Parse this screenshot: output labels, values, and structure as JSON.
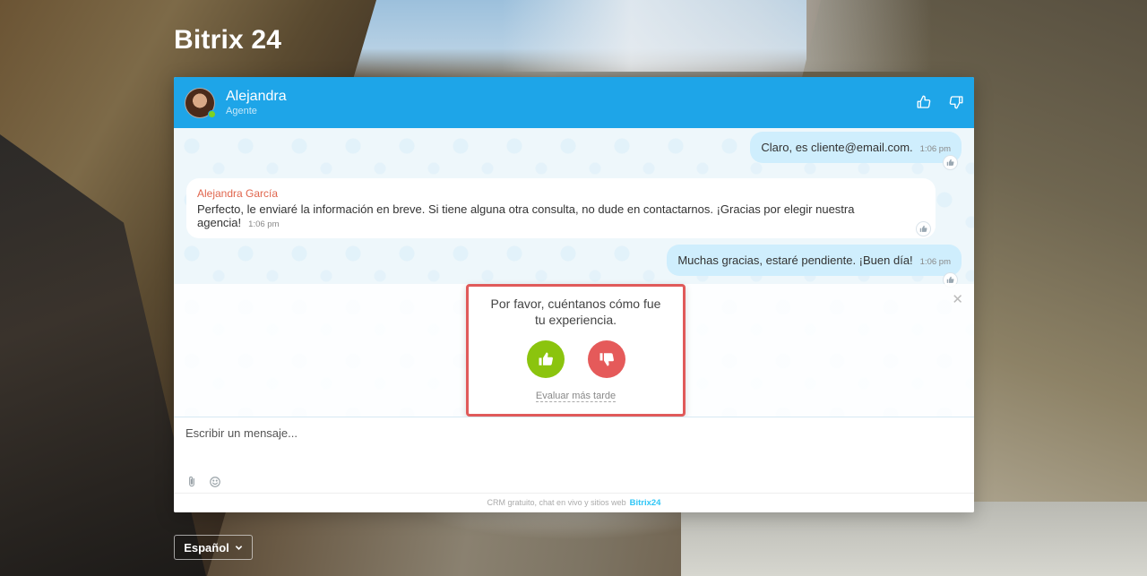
{
  "brand": {
    "title": "Bitrix 24"
  },
  "header": {
    "agent_name": "Alejandra",
    "agent_role": "Agente",
    "like_icon": "thumbs-up-icon",
    "dislike_icon": "thumbs-down-icon"
  },
  "messages": [
    {
      "direction": "out",
      "text": "Claro, es cliente@email.com.",
      "time": "1:06 pm"
    },
    {
      "direction": "in",
      "author": "Alejandra García",
      "text": "Perfecto, le enviaré la información en breve. Si tiene alguna otra consulta, no dude en contactarnos. ¡Gracias por elegir nuestra agencia!",
      "time": "1:06 pm"
    },
    {
      "direction": "out",
      "text": "Muchas gracias, estaré pendiente. ¡Buen día!",
      "time": "1:06 pm"
    }
  ],
  "rating": {
    "question": "Por favor, cuéntanos cómo fue tu experiencia.",
    "later": "Evaluar más tarde"
  },
  "composer": {
    "placeholder": "Escribir un mensaje..."
  },
  "footer": {
    "text": "CRM gratuito, chat en vivo y sitios web",
    "logo": "Bitrix24"
  },
  "language": {
    "selected": "Español"
  },
  "colors": {
    "header": "#1ea5e8",
    "like": "#8bc40e",
    "dislike": "#e55a5a",
    "highlight": "#e05a5a"
  }
}
